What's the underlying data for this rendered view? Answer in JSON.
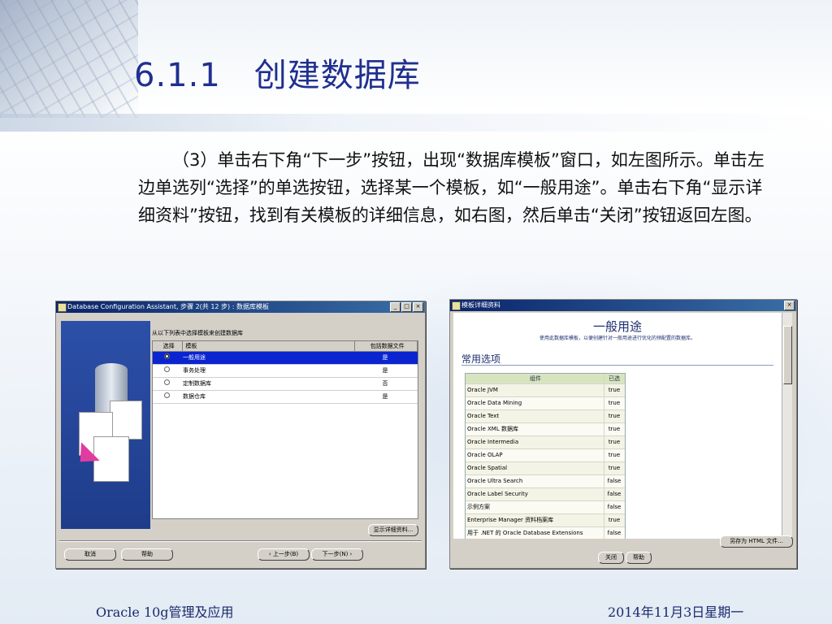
{
  "slide": {
    "title": "6.1.1　创建数据库",
    "body": "（3）单击右下角“下一步”按钮，出现“数据库模板”窗口，如左图所示。单击左边单选列“选择”的单选按钮，选择某一个模板，如“一般用途”。单击右下角“显示详细资料”按钮，找到有关模板的详细信息，如右图，然后单击“关闭”按钮返回左图。",
    "footer_left": "Oracle 10g管理及应用",
    "footer_right": "2014年11月3日星期一"
  },
  "left_window": {
    "title": "Database Configuration Assistant, 步骤 2(共 12 步) : 数据库模板",
    "title_buttons": [
      "_",
      "□",
      "×"
    ],
    "prompt": "从以下列表中选择模板来创建数据库",
    "columns": [
      "选择",
      "模板",
      "包括数据文件"
    ],
    "rows": [
      {
        "template": "一般用途",
        "includes": "是",
        "selected": true
      },
      {
        "template": "事务处理",
        "includes": "是",
        "selected": false
      },
      {
        "template": "定制数据库",
        "includes": "否",
        "selected": false
      },
      {
        "template": "数据仓库",
        "includes": "是",
        "selected": false
      }
    ],
    "details_button": "显示详细资料...",
    "cancel_button": "取消",
    "help_button": "帮助",
    "back_button": "上一步(B)",
    "next_button": "下一步(N)"
  },
  "right_window": {
    "title": "模板详细资料",
    "close_x": "×",
    "heading": "一般用途",
    "description": "使用此数据库模板，以便创建针对一般用途进行优化的预配置的数据库。",
    "section": "常用选项",
    "columns": [
      "组件",
      "已选"
    ],
    "rows": [
      {
        "name": "Oracle JVM",
        "value": "true"
      },
      {
        "name": "Oracle Data Mining",
        "value": "true"
      },
      {
        "name": "Oracle Text",
        "value": "true"
      },
      {
        "name": "Oracle XML 数据库",
        "value": "true"
      },
      {
        "name": "Oracle Intermedia",
        "value": "true"
      },
      {
        "name": "Oracle OLAP",
        "value": "true"
      },
      {
        "name": "Oracle Spatial",
        "value": "true"
      },
      {
        "name": "Oracle Ultra Search",
        "value": "false"
      },
      {
        "name": "Oracle Label Security",
        "value": "false"
      },
      {
        "name": "示例方案",
        "value": "false"
      },
      {
        "name": "Enterprise Manager 资料档案库",
        "value": "true"
      },
      {
        "name": "用于 .NET 的 Oracle Database Extensions",
        "value": "false"
      }
    ],
    "save_html_button": "另存为 HTML 文件...",
    "close_button": "关闭",
    "help_button": "帮助"
  },
  "colors": {
    "title": "#1f2f8f",
    "selection": "#0a24d0",
    "titlebar": "#0a246a"
  }
}
